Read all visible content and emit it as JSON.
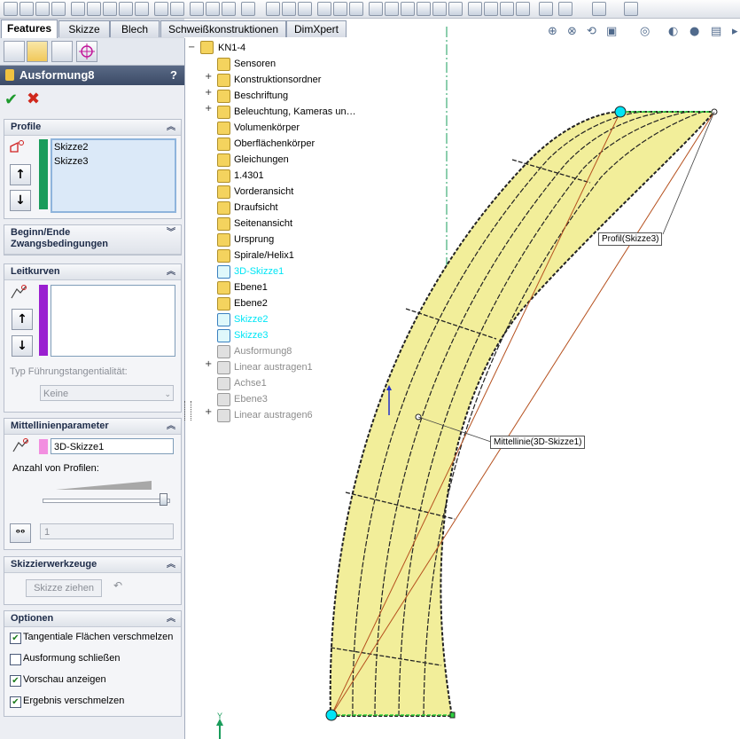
{
  "tabs": [
    {
      "label": "Features",
      "active": true
    },
    {
      "label": "Skizze"
    },
    {
      "label": "Blech"
    },
    {
      "label": "Schweißkonstruktionen"
    },
    {
      "label": "DimXpert"
    }
  ],
  "feature": {
    "title": "Ausformung8",
    "help": "?"
  },
  "profile": {
    "header": "Profile",
    "items": [
      "Skizze2",
      "Skizze3"
    ]
  },
  "begin_end": {
    "header_line1": "Beginn/Ende",
    "header_line2": "Zwangsbedingungen"
  },
  "leitkurven": {
    "header": "Leitkurven",
    "tangency_label": "Typ Führungstangentialität:",
    "tangency_value": "Keine"
  },
  "mittellinie": {
    "header": "Mittellinienparameter",
    "value": "3D-Skizze1",
    "count_label": "Anzahl von Profilen:",
    "spin_value": "1"
  },
  "skizzier": {
    "header": "Skizzierwerkzeuge",
    "button": "Skizze ziehen"
  },
  "optionen": {
    "header": "Optionen",
    "items": [
      {
        "label": "Tangentiale Flächen verschmelzen",
        "checked": true
      },
      {
        "label": "Ausformung schließen",
        "checked": false
      },
      {
        "label": "Vorschau anzeigen",
        "checked": true
      },
      {
        "label": "Ergebnis verschmelzen",
        "checked": true
      }
    ]
  },
  "tree": {
    "root": "KN1-4",
    "items": [
      {
        "label": "Sensoren",
        "expand": false,
        "style": "normal"
      },
      {
        "label": "Konstruktionsordner",
        "expand": true,
        "style": "normal"
      },
      {
        "label": "Beschriftung",
        "expand": true,
        "style": "normal"
      },
      {
        "label": "Beleuchtung, Kameras un…",
        "expand": true,
        "style": "normal"
      },
      {
        "label": "Volumenkörper",
        "expand": false,
        "style": "normal"
      },
      {
        "label": "Oberflächenkörper",
        "expand": false,
        "style": "normal"
      },
      {
        "label": "Gleichungen",
        "expand": false,
        "style": "normal"
      },
      {
        "label": "1.4301",
        "expand": false,
        "style": "normal"
      },
      {
        "label": "Vorderansicht",
        "expand": false,
        "style": "normal"
      },
      {
        "label": "Draufsicht",
        "expand": false,
        "style": "normal"
      },
      {
        "label": "Seitenansicht",
        "expand": false,
        "style": "normal"
      },
      {
        "label": "Ursprung",
        "expand": false,
        "style": "normal"
      },
      {
        "label": "Spirale/Helix1",
        "expand": false,
        "style": "normal"
      },
      {
        "label": "3D-Skizze1",
        "expand": false,
        "style": "cyan"
      },
      {
        "label": "Ebene1",
        "expand": false,
        "style": "normal"
      },
      {
        "label": "Ebene2",
        "expand": false,
        "style": "normal"
      },
      {
        "label": "Skizze2",
        "expand": false,
        "style": "cyan"
      },
      {
        "label": "Skizze3",
        "expand": false,
        "style": "cyan"
      },
      {
        "label": "Ausformung8",
        "expand": false,
        "style": "gray"
      },
      {
        "label": "Linear austragen1",
        "expand": true,
        "style": "gray"
      },
      {
        "label": "Achse1",
        "expand": false,
        "style": "gray"
      },
      {
        "label": "Ebene3",
        "expand": false,
        "style": "gray"
      },
      {
        "label": "Linear austragen6",
        "expand": true,
        "style": "gray"
      }
    ]
  },
  "callouts": {
    "profil": "Profil(Skizze3)",
    "mittellinie": "Mittellinie(3D-Skizze1)"
  },
  "axis": {
    "y_label": "Y"
  },
  "colors": {
    "surface": "#f2ee9a",
    "cyan": "#00e5f5",
    "green": "#1a9c5b",
    "purple": "#9a1fd0",
    "pink": "#f28ee0"
  }
}
